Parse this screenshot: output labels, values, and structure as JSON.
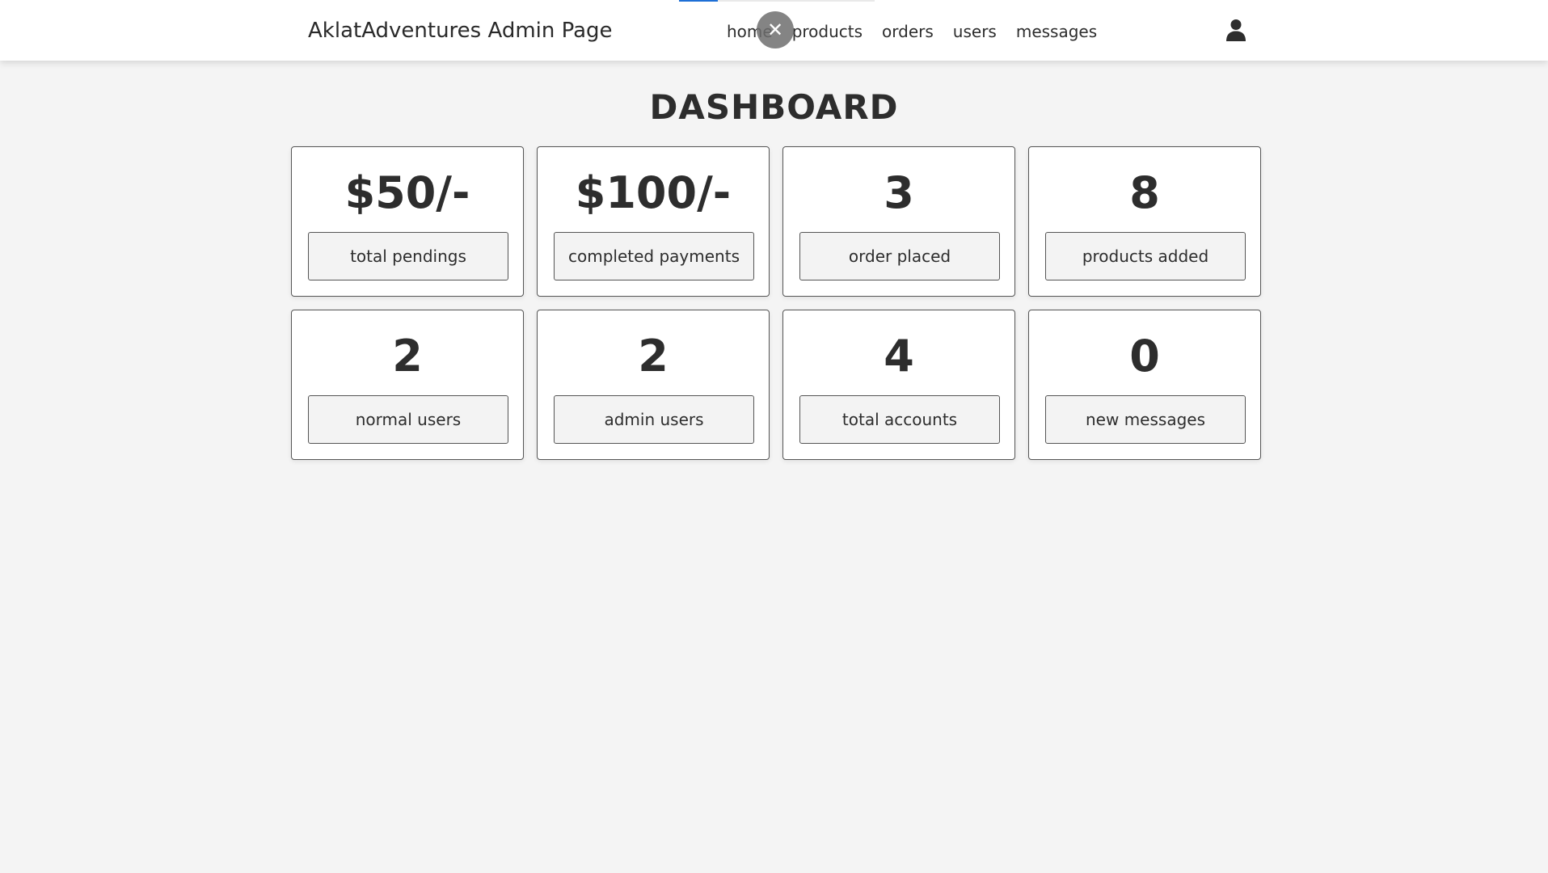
{
  "header": {
    "logo": "AklatAdventures Admin Page",
    "nav": [
      "home",
      "products",
      "orders",
      "users",
      "messages"
    ],
    "close_glyph": "✕",
    "user_icon": "user-icon",
    "loading_progress": 0.2
  },
  "page": {
    "title": "DASHBOARD"
  },
  "cards": [
    {
      "value": "$50/-",
      "label": "total pendings"
    },
    {
      "value": "$100/-",
      "label": "completed payments"
    },
    {
      "value": "3",
      "label": "order placed"
    },
    {
      "value": "8",
      "label": "products added"
    },
    {
      "value": "2",
      "label": "normal users"
    },
    {
      "value": "2",
      "label": "admin users"
    },
    {
      "value": "4",
      "label": "total accounts"
    },
    {
      "value": "0",
      "label": "new messages"
    }
  ],
  "colors": {
    "background": "#f4f4f4",
    "card": "#ffffff",
    "text": "#2d2d2d",
    "accent": "#1e6fd6"
  }
}
